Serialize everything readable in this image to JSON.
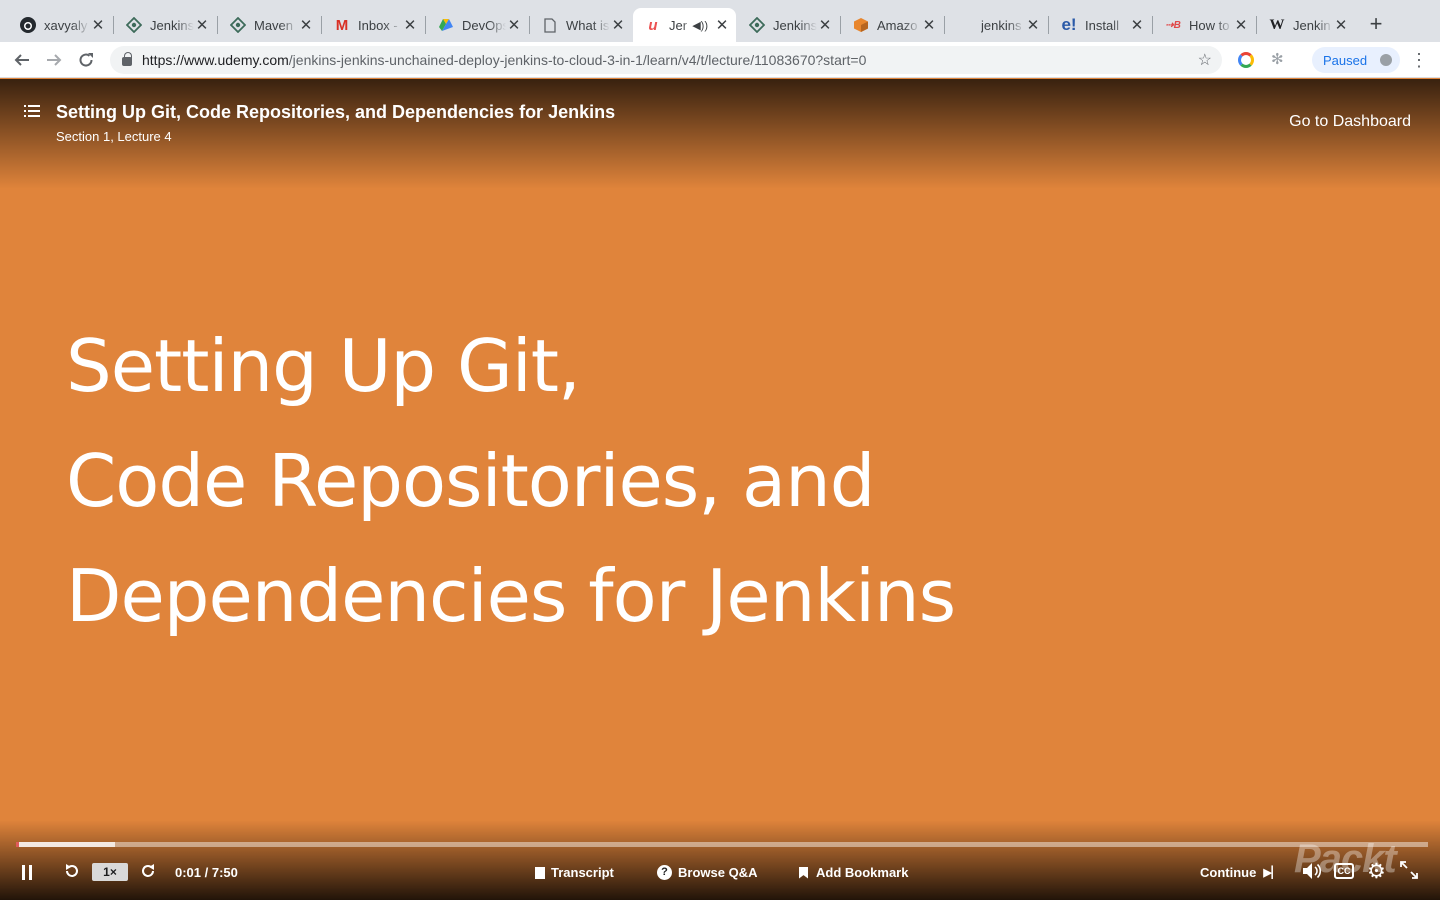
{
  "tabs": [
    {
      "title": "xavyaly",
      "icon": "github-icon",
      "active": false
    },
    {
      "title": "Jenkins",
      "icon": "jenkins-icon",
      "active": false
    },
    {
      "title": "Maven",
      "icon": "jenkins-icon",
      "active": false
    },
    {
      "title": "Inbox -",
      "icon": "gmail-icon",
      "active": false
    },
    {
      "title": "DevOps",
      "icon": "google-drive-icon",
      "active": false
    },
    {
      "title": "What is",
      "icon": "document-icon",
      "active": false
    },
    {
      "title": "Jer",
      "icon": "udemy-icon",
      "active": true,
      "audio": true
    },
    {
      "title": "Jenkins",
      "icon": "jenkins-icon",
      "active": false
    },
    {
      "title": "Amazo",
      "icon": "aws-icon",
      "active": false
    },
    {
      "title": "jenkins",
      "icon": "blank-icon",
      "active": false
    },
    {
      "title": "Install",
      "icon": "e-icon",
      "active": false
    },
    {
      "title": "How to",
      "icon": "b-icon",
      "active": false
    },
    {
      "title": "Jenkin",
      "icon": "wikipedia-icon",
      "active": false
    }
  ],
  "toolbar": {
    "url_host": "https://www.udemy.com",
    "url_path": "/jenkins-jenkins-unchained-deploy-jenkins-to-cloud-3-in-1/learn/v4/t/lecture/11083670?start=0",
    "profile_status": "Paused"
  },
  "player": {
    "lecture_title": "Setting Up Git, Code Repositories, and Dependencies for Jenkins",
    "lecture_subtitle": "Section 1, Lecture 4",
    "dashboard_link": "Go to Dashboard",
    "slide_lines": [
      "Setting Up Git,",
      "Code Repositories, and",
      "Dependencies for Jenkins"
    ],
    "watermark": "Packt",
    "progress_played": 0.002,
    "progress_buffered": 0.07,
    "speed": "1×",
    "time": "0:01 / 7:50",
    "transcript_label": "Transcript",
    "qa_label": "Browse Q&A",
    "bookmark_label": "Add Bookmark",
    "continue_label": "Continue",
    "cc_label": "CC",
    "accent_color": "#e05b5b",
    "slide_background": "#e0843b"
  }
}
